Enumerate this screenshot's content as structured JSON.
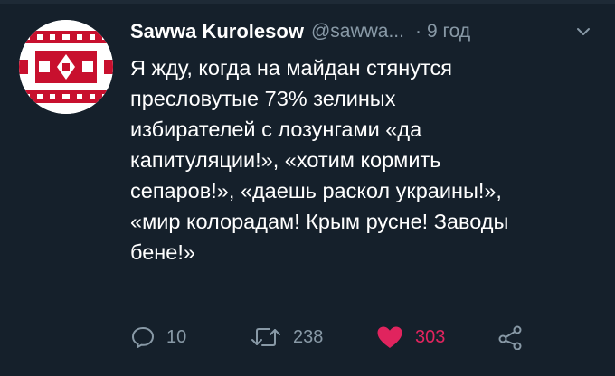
{
  "tweet": {
    "author": {
      "display_name": "Sawwa Kurolesow",
      "handle": "@sawwa...",
      "avatar_icon": "belarusian-ornament-avatar"
    },
    "separator": "·",
    "time": "9 год",
    "menu_icon": "chevron-down-icon",
    "text_lines": [
      "Я жду,  когда на майдан стянутся",
      "пресловутые 73% зелиных",
      "избирателей с лозунгами «да",
      "капитуляции!», «хотим кормить",
      "сепаров!», «даешь раскол украины!»,",
      "«мир колорадам! Крым русне! Заводы",
      "бене!»"
    ],
    "actions": {
      "reply": {
        "icon": "reply-icon",
        "count": "10"
      },
      "retweet": {
        "icon": "retweet-icon",
        "count": "238"
      },
      "like": {
        "icon": "heart-icon",
        "count": "303",
        "liked": true
      },
      "share": {
        "icon": "share-icon"
      }
    }
  },
  "colors": {
    "background": "#15202b",
    "secondary_text": "#8899a6",
    "like_active": "#e0245e",
    "avatar_red": "#c8102e"
  }
}
